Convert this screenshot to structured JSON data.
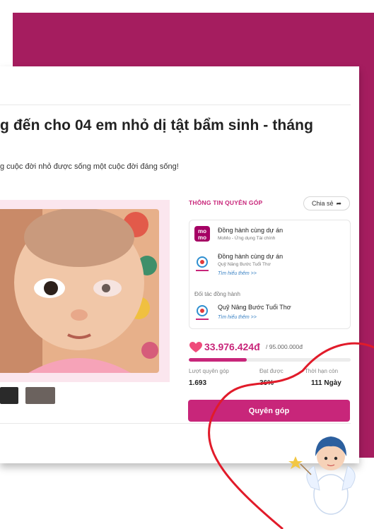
{
  "campaign": {
    "title": "g đến cho 04 em nhỏ dị tật bẩm sinh - tháng",
    "subtitle": "g cuộc đời nhỏ được sống một cuộc đời đáng sống!"
  },
  "donation_info": {
    "section_title": "THÔNG TIN QUYÊN GÓP",
    "share_label": "Chia sẻ",
    "partners": [
      {
        "logo": "momo-logo",
        "name": "Đồng hành cùng dự án",
        "org": "MoMo - Ứng dụng Tài chính"
      },
      {
        "logo": "buoc-tuoi-tho-logo",
        "name": "Đồng hành cùng dự án",
        "org": "Quỹ Nâng Bước Tuổi Thơ",
        "link": "Tìm hiểu thêm >>"
      }
    ],
    "companion_label": "Đối tác đồng hành",
    "companion": {
      "logo": "buoc-tuoi-tho-logo",
      "name": "Quỹ Nâng Bước Tuổi Thơ",
      "link": "Tìm hiểu thêm >>"
    },
    "raised": "33.976.424đ",
    "goal": "/ 95.000.000đ",
    "progress_fraction": 0.36,
    "stats": [
      {
        "label": "Lượt quyên góp",
        "value": "1.693"
      },
      {
        "label": "Đạt được",
        "value": "36%"
      },
      {
        "label": "Thời hạn còn",
        "value": "111 Ngày"
      }
    ],
    "donate_label": "Quyên góp"
  },
  "colors": {
    "accent": "#c8267a",
    "frame": "#a51d5f",
    "heart": "#e11b2a"
  }
}
